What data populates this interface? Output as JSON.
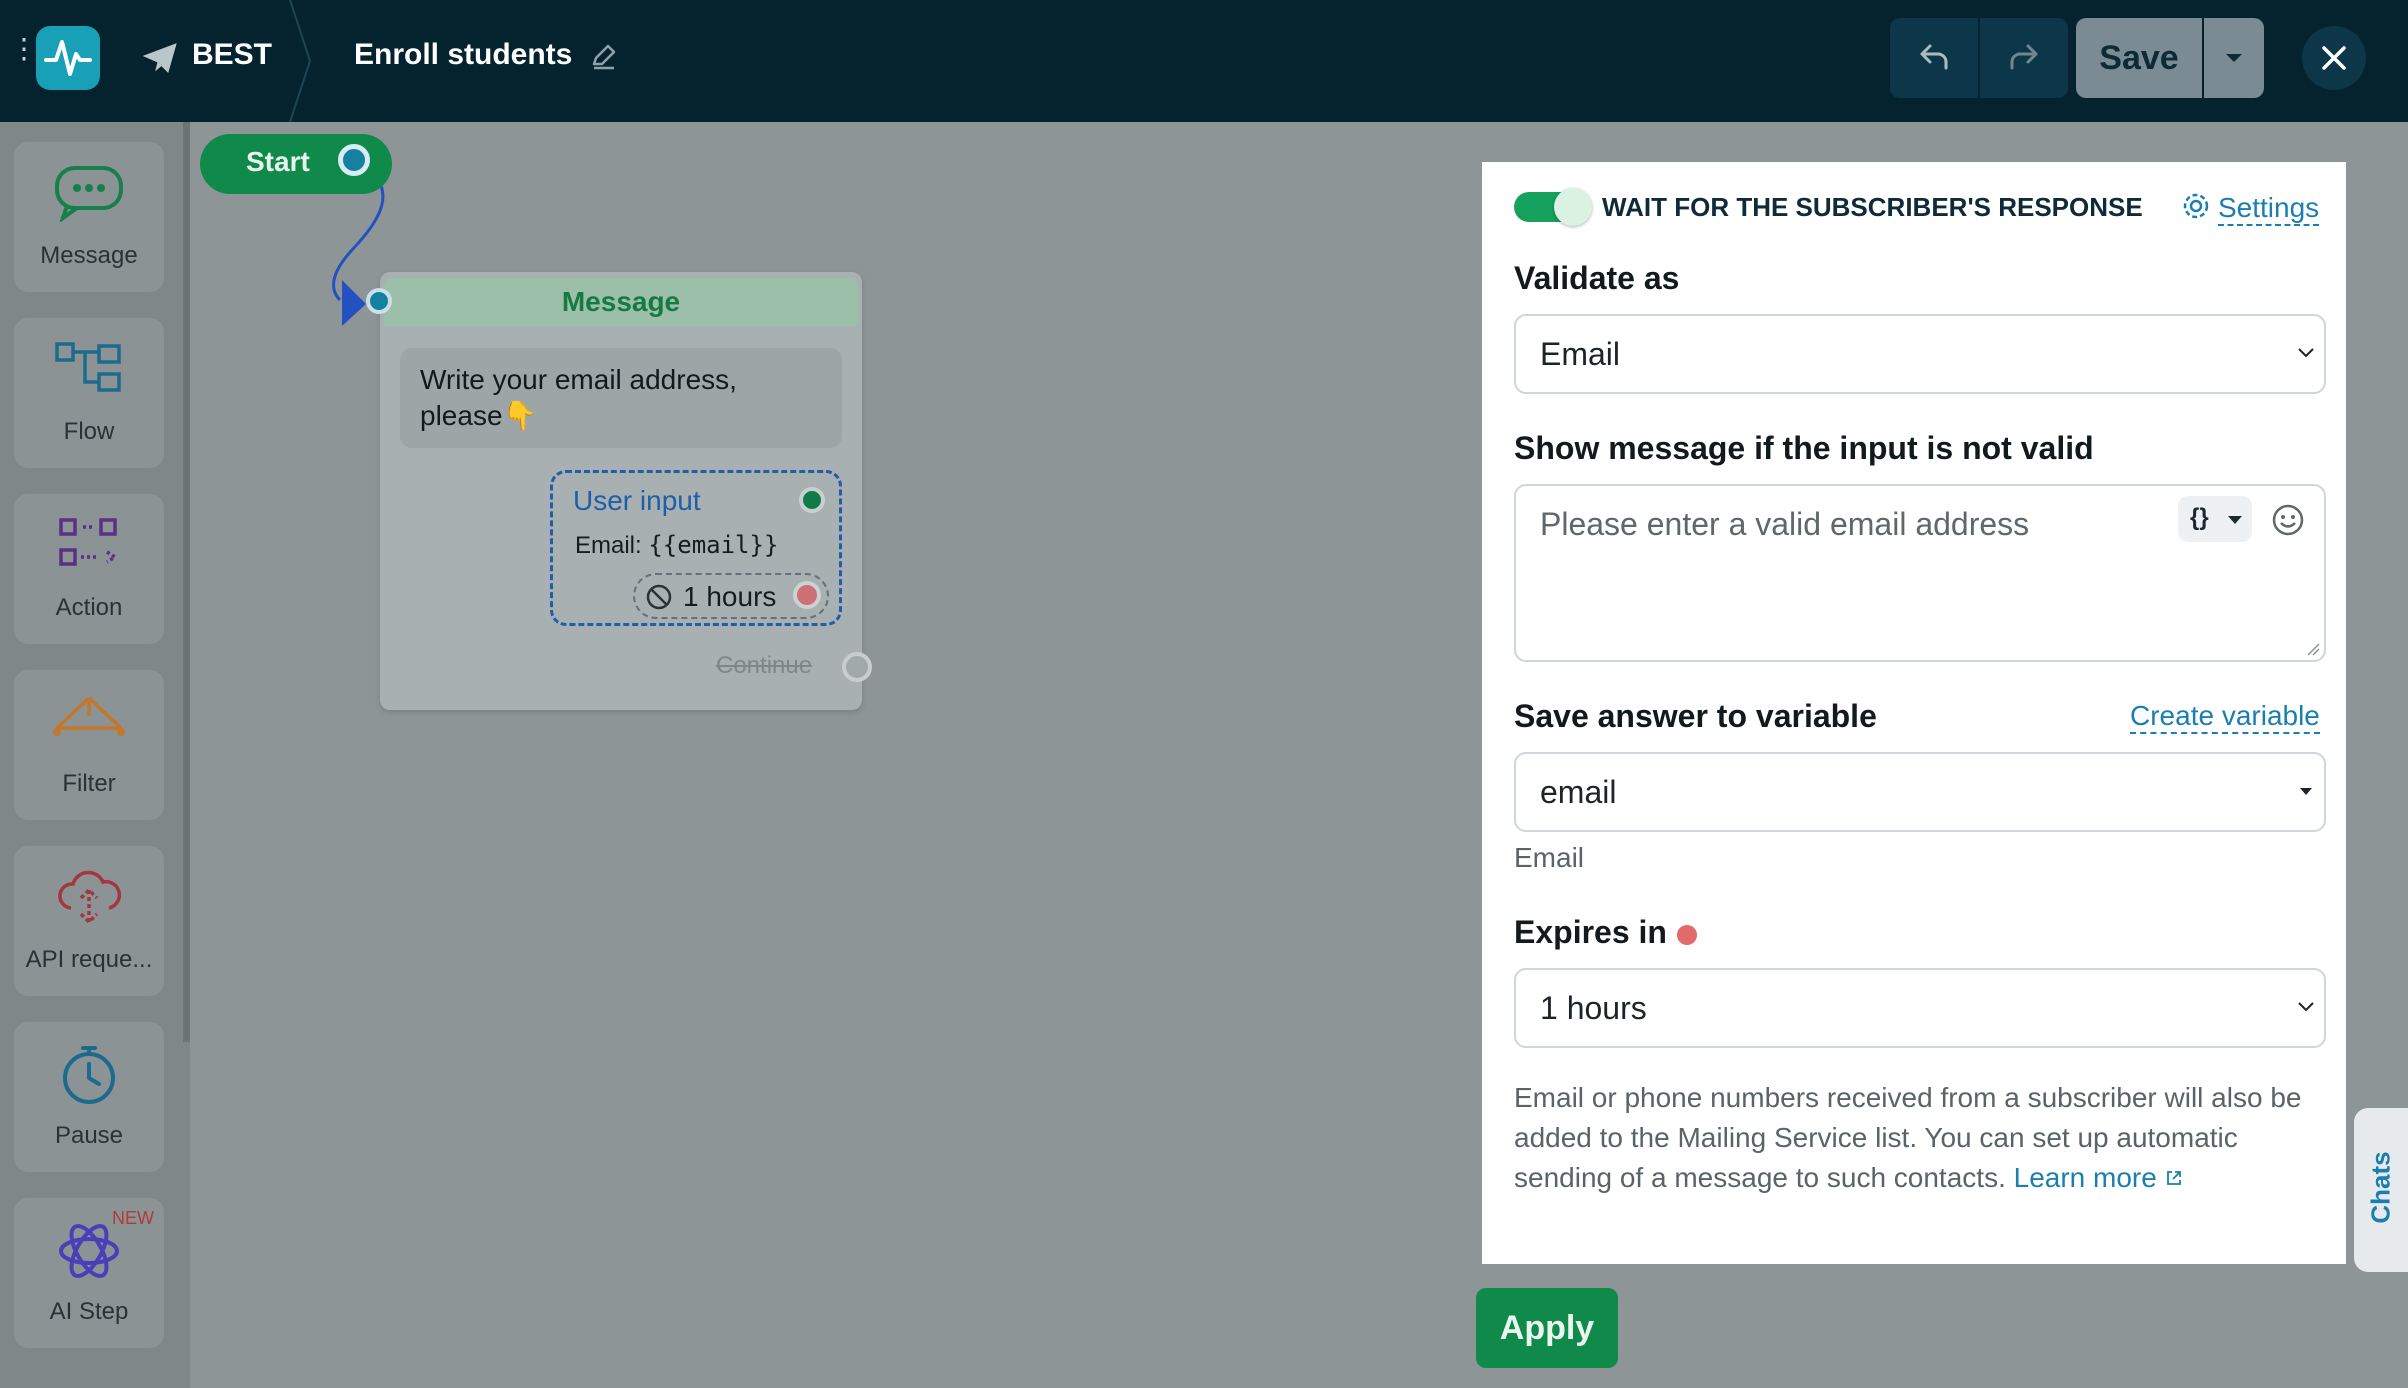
{
  "topbar": {
    "bot_name": "BEST",
    "flow_title": "Enroll students",
    "save_label": "Save"
  },
  "toolbox": {
    "items": [
      {
        "label": "Message",
        "icon": "message-bubble-icon"
      },
      {
        "label": "Flow",
        "icon": "flow-icon"
      },
      {
        "label": "Action",
        "icon": "action-icon"
      },
      {
        "label": "Filter",
        "icon": "filter-icon"
      },
      {
        "label": "API reque...",
        "icon": "cloud-api-icon"
      },
      {
        "label": "Pause",
        "icon": "stopwatch-icon"
      },
      {
        "label": "AI Step",
        "icon": "atom-icon",
        "badge": "NEW"
      }
    ]
  },
  "canvas": {
    "start_label": "Start",
    "message_node": {
      "header": "Message",
      "text": "Write your email address, please👇",
      "user_input_title": "User input",
      "email_prefix": "Email:",
      "email_var": "{{email}}",
      "timeout": "1 hours",
      "continue_label": "Continue"
    }
  },
  "panel": {
    "wait_label": "WAIT FOR THE SUBSCRIBER'S RESPONSE",
    "settings_label": "Settings",
    "validate_label": "Validate as",
    "validate_value": "Email",
    "invalid_msg_label": "Show message if the input is not valid",
    "invalid_msg_placeholder": "Please enter a valid email address",
    "var_button": "{}",
    "save_var_label": "Save answer to variable",
    "create_var_label": "Create variable",
    "variable_value": "email",
    "variable_type": "Email",
    "expires_label": "Expires in",
    "expires_value": "1 hours",
    "note": "Email or phone numbers received from a subscriber will also be added to the Mailing Service list. You can set up automatic sending of a message to such contacts.",
    "learn_more": "Learn more",
    "apply_label": "Apply"
  },
  "chats_tab": "Chats",
  "colors": {
    "topbar_bg": "#04232f",
    "accent_green": "#0f8a4a",
    "link_blue": "#1a7fb0",
    "required_red": "#e26a6a"
  }
}
